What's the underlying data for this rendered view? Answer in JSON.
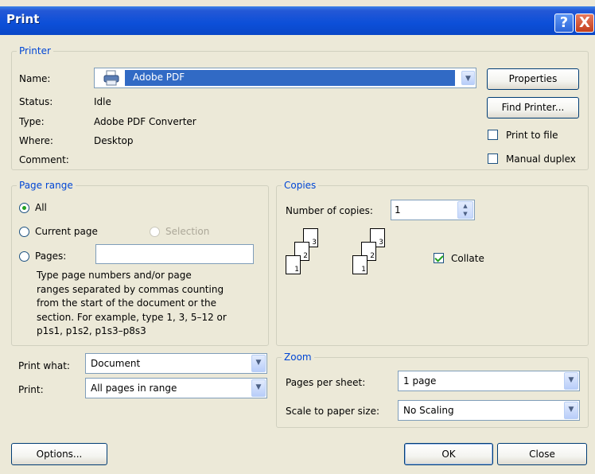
{
  "title": "Print",
  "help_glyph": "?",
  "close_glyph": "X",
  "printer": {
    "legend": "Printer",
    "name_label": "Name:",
    "name_value": "Adobe PDF",
    "status_label": "Status:",
    "status_value": "Idle",
    "type_label": "Type:",
    "type_value": "Adobe PDF Converter",
    "where_label": "Where:",
    "where_value": "Desktop",
    "comment_label": "Comment:",
    "properties_button": "Properties",
    "find_printer_button": "Find Printer...",
    "print_to_file_label": "Print to file",
    "manual_duplex_label": "Manual duplex"
  },
  "page_range": {
    "legend": "Page range",
    "all_label": "All",
    "current_page_label": "Current page",
    "selection_label": "Selection",
    "pages_label": "Pages:",
    "pages_value": "",
    "help_lines": [
      "Type page numbers and/or page",
      "ranges separated by commas counting",
      "from the start of the document or the",
      "section. For example, type 1, 3, 5–12 or",
      "p1s1, p1s2, p1s3–p8s3"
    ]
  },
  "copies": {
    "legend": "Copies",
    "number_label": "Number of copies:",
    "number_value": "1",
    "collate_label": "Collate",
    "page_numbers": [
      "1",
      "2",
      "3"
    ],
    "spin_up": "▲",
    "spin_down": "▼"
  },
  "print_what": {
    "label": "Print what:",
    "value": "Document"
  },
  "print": {
    "label": "Print:",
    "value": "All pages in range"
  },
  "zoom": {
    "legend": "Zoom",
    "pages_per_sheet_label": "Pages per sheet:",
    "pages_per_sheet_value": "1 page",
    "scale_label": "Scale to paper size:",
    "scale_value": "No Scaling"
  },
  "buttons": {
    "options": "Options...",
    "ok": "OK",
    "close": "Close"
  },
  "icons": {
    "dropdown": "▼"
  },
  "colors": {
    "title_bar": "#0a47c7",
    "legend_text": "#0046d5",
    "selection_highlight": "#316ac5",
    "check_green": "#21a121",
    "dialog_bg": "#ece9d8"
  }
}
